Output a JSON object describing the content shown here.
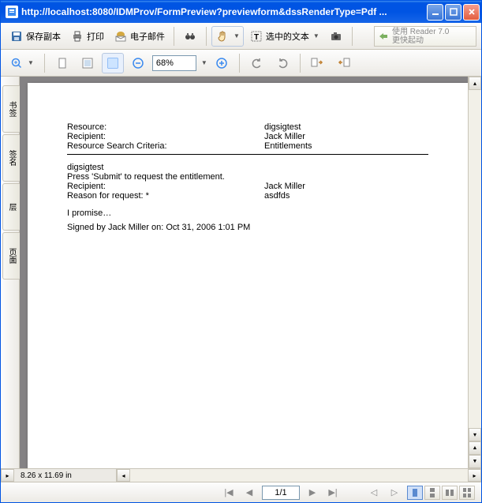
{
  "titlebar": {
    "url": "http://localhost:8080/IDMProv/FormPreview?previewform&dssRenderType=Pdf ..."
  },
  "toolbar1": {
    "save_copy": "保存副本",
    "print": "打印",
    "email": "电子邮件",
    "selected_text": "选中的文本",
    "reader_line1": "使用 Reader 7.0",
    "reader_line2": "更快起动"
  },
  "toolbar2": {
    "zoom_value": "68%"
  },
  "side_tabs": {
    "t0": "书签",
    "t1": "签名",
    "t2": "层",
    "t3": "页面"
  },
  "document": {
    "rows1": {
      "r0l": "Resource:",
      "r0v": "digsigtest",
      "r1l": "Recipient:",
      "r1v": "Jack Miller",
      "r2l": "Resource Search Criteria:",
      "r2v": "Entitlements"
    },
    "block2": {
      "l0": "digsigtest",
      "l1": "Press 'Submit' to request the entitlement.",
      "r2l": "Recipient:",
      "r2v": "Jack Miller",
      "r3l": "Reason for request: *",
      "r3v": "asdfds"
    },
    "promise": "I promise…",
    "signed": "Signed by Jack Miller on: Oct 31, 2006 1:01 PM"
  },
  "statusbar": {
    "page_size": "8.26 x 11.69 in",
    "page_num": "1/1"
  }
}
